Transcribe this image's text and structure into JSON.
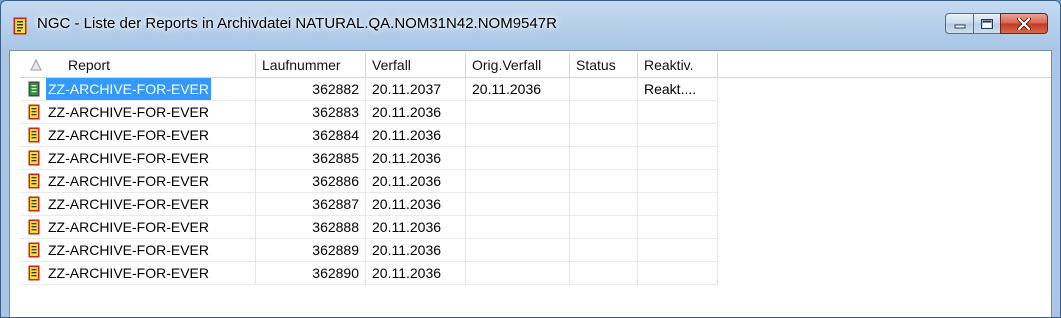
{
  "window": {
    "title": "NGC - Liste der Reports in Archivdatei NATURAL.QA.NOM31N42.NOM9547R",
    "app_icon": "report-document-icon"
  },
  "table": {
    "sort_icon": "sort-triangle-icon",
    "columns": [
      {
        "key": "report",
        "label": "Report"
      },
      {
        "key": "laufnummer",
        "label": "Laufnummer"
      },
      {
        "key": "verfall",
        "label": "Verfall"
      },
      {
        "key": "orig_verfall",
        "label": "Orig.Verfall"
      },
      {
        "key": "status",
        "label": "Status"
      },
      {
        "key": "reaktiv",
        "label": "Reaktiv."
      }
    ],
    "rows": [
      {
        "icon": "green-report-icon",
        "report": "ZZ-ARCHIVE-FOR-EVER",
        "laufnummer": "362882",
        "verfall": "20.11.2037",
        "orig_verfall": "20.11.2036",
        "status": "",
        "reaktiv": "Reakt....",
        "selected": true
      },
      {
        "icon": "yellow-report-icon",
        "report": "ZZ-ARCHIVE-FOR-EVER",
        "laufnummer": "362883",
        "verfall": "20.11.2036",
        "orig_verfall": "",
        "status": "",
        "reaktiv": ""
      },
      {
        "icon": "yellow-report-icon",
        "report": "ZZ-ARCHIVE-FOR-EVER",
        "laufnummer": "362884",
        "verfall": "20.11.2036",
        "orig_verfall": "",
        "status": "",
        "reaktiv": ""
      },
      {
        "icon": "yellow-report-icon",
        "report": "ZZ-ARCHIVE-FOR-EVER",
        "laufnummer": "362885",
        "verfall": "20.11.2036",
        "orig_verfall": "",
        "status": "",
        "reaktiv": ""
      },
      {
        "icon": "yellow-report-icon",
        "report": "ZZ-ARCHIVE-FOR-EVER",
        "laufnummer": "362886",
        "verfall": "20.11.2036",
        "orig_verfall": "",
        "status": "",
        "reaktiv": ""
      },
      {
        "icon": "yellow-report-icon",
        "report": "ZZ-ARCHIVE-FOR-EVER",
        "laufnummer": "362887",
        "verfall": "20.11.2036",
        "orig_verfall": "",
        "status": "",
        "reaktiv": ""
      },
      {
        "icon": "yellow-report-icon",
        "report": "ZZ-ARCHIVE-FOR-EVER",
        "laufnummer": "362888",
        "verfall": "20.11.2036",
        "orig_verfall": "",
        "status": "",
        "reaktiv": ""
      },
      {
        "icon": "yellow-report-icon",
        "report": "ZZ-ARCHIVE-FOR-EVER",
        "laufnummer": "362889",
        "verfall": "20.11.2036",
        "orig_verfall": "",
        "status": "",
        "reaktiv": ""
      },
      {
        "icon": "yellow-report-icon",
        "report": "ZZ-ARCHIVE-FOR-EVER",
        "laufnummer": "362890",
        "verfall": "20.11.2036",
        "orig_verfall": "",
        "status": "",
        "reaktiv": ""
      }
    ]
  },
  "colors": {
    "selection": "#3399ff",
    "report_icon_yellow": "#f7e12e",
    "report_icon_border": "#d2201a",
    "report_icon_green": "#2f8f3a"
  }
}
